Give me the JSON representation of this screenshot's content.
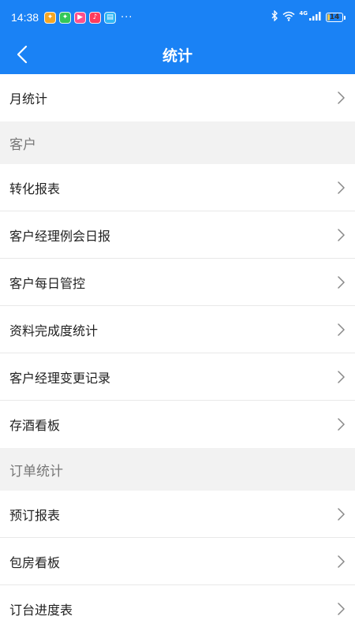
{
  "status_bar": {
    "time": "14:38",
    "notifications": [
      {
        "icon": "app-notification-icon",
        "color": "#f5a623"
      },
      {
        "icon": "app-notification-icon",
        "color": "#34c759"
      },
      {
        "icon": "video-app-icon",
        "color": "#ff4f8b"
      },
      {
        "icon": "music-app-icon",
        "color": "#ff3b5c"
      },
      {
        "icon": "message-app-icon",
        "color": "#2fb6f5"
      }
    ],
    "more": "···",
    "network": "4G",
    "battery": "14",
    "battery_level": 0.14
  },
  "header": {
    "title": "统计"
  },
  "list": {
    "monthly": "月统计",
    "customer_section": "客户",
    "customer_items": [
      "转化报表",
      "客户经理例会日报",
      "客户每日管控",
      "资料完成度统计",
      "客户经理变更记录",
      "存酒看板"
    ],
    "order_section": "订单统计",
    "order_items": [
      "预订报表",
      "包房看板",
      "订台进度表"
    ]
  },
  "colors": {
    "primary": "#1a82f5",
    "section_bg": "#f2f2f2",
    "chevron": "#888888"
  }
}
